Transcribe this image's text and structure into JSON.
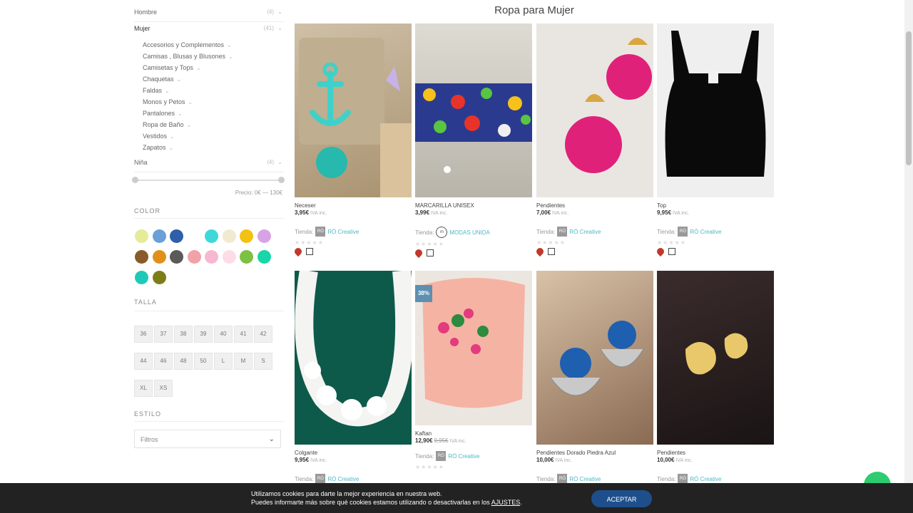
{
  "sidebar": {
    "categories": [
      {
        "label": "Hombre",
        "count": "(4)"
      },
      {
        "label": "Mujer",
        "count": "(41)"
      },
      {
        "label": "Niña",
        "count": "(4)"
      }
    ],
    "mujer_subcategories": [
      "Accesorios y Complementos",
      "Camisas , Blusas y Blusones",
      "Camisetas y Tops",
      "Chaquetas",
      "Faldas",
      "Monos y Petos",
      "Pantalones",
      "Ropa de Baño",
      "Vestidos",
      "Zapatos"
    ],
    "price_label": "Precio: 0€ — 130€",
    "color_title": "COLOR",
    "colors": [
      "#e4ec9a",
      "#6a9fd8",
      "#2f5fa8",
      "#3fd8d8",
      "#f0ead0",
      "#f3c211",
      "#d7a3e6",
      "#8b5a2b",
      "#e0901a",
      "#5a5a5a",
      "#f1a1a8",
      "#f5b8d0",
      "#fcdde6",
      "#7dc142",
      "#19d6a8",
      "#1fc9b8",
      "#7d7d17"
    ],
    "size_title": "TALLA",
    "sizes": [
      "36",
      "37",
      "38",
      "39",
      "40",
      "41",
      "42",
      "44",
      "46",
      "48",
      "50",
      "L",
      "M",
      "S",
      "XL",
      "XS"
    ],
    "style_title": "ESTILO",
    "style_select": "Filtros"
  },
  "main": {
    "title": "Ropa para Mujer",
    "products": [
      {
        "name": "Neceser",
        "price": "3,95€",
        "old_price": "",
        "iva": "IVA inc.",
        "store_label": "Tienda:",
        "store": "RÓ Creative",
        "store_logo": "RÓ",
        "badge": ""
      },
      {
        "name": "MARCARILLA UNISEX",
        "price": "3,99€",
        "old_price": "",
        "iva": "IVA inc.",
        "store_label": "Tienda:",
        "store": "MODAS UNIDA",
        "store_logo": "m",
        "badge": ""
      },
      {
        "name": "Pendientes",
        "price": "7,00€",
        "old_price": "",
        "iva": "IVA inc.",
        "store_label": "Tienda:",
        "store": "RÓ Creative",
        "store_logo": "RÓ",
        "badge": ""
      },
      {
        "name": "Top",
        "price": "9,95€",
        "old_price": "",
        "iva": "IVA inc.",
        "store_label": "Tienda:",
        "store": "RÓ Creative",
        "store_logo": "RÓ",
        "badge": ""
      },
      {
        "name": "Colgante",
        "price": "9,95€",
        "old_price": "",
        "iva": "IVA inc.",
        "store_label": "Tienda:",
        "store": "RÓ Creative",
        "store_logo": "RÓ",
        "badge": ""
      },
      {
        "name": "Kaftan",
        "price": "12,90€",
        "old_price": "9,95€",
        "iva": "IVA inc.",
        "store_label": "Tienda:",
        "store": "RÓ Creative",
        "store_logo": "RÓ",
        "badge": "38%"
      },
      {
        "name": "Pendientes Dorado Piedra Azul",
        "price": "10,00€",
        "old_price": "",
        "iva": "IVA inc.",
        "store_label": "Tienda:",
        "store": "RÓ Creative",
        "store_logo": "RÓ",
        "badge": ""
      },
      {
        "name": "Pendientes",
        "price": "10,00€",
        "old_price": "",
        "iva": "IVA inc.",
        "store_label": "Tienda:",
        "store": "RÓ Creative",
        "store_logo": "RÓ",
        "badge": ""
      }
    ]
  },
  "cookie": {
    "line1": "Utilizamos cookies para darte la mejor experiencia en nuestra web.",
    "line2": "Puedes informarte más sobre qué cookies estamos utilizando o desactivarlas en los",
    "link": "AJUSTES",
    "accept": "ACEPTAR"
  }
}
